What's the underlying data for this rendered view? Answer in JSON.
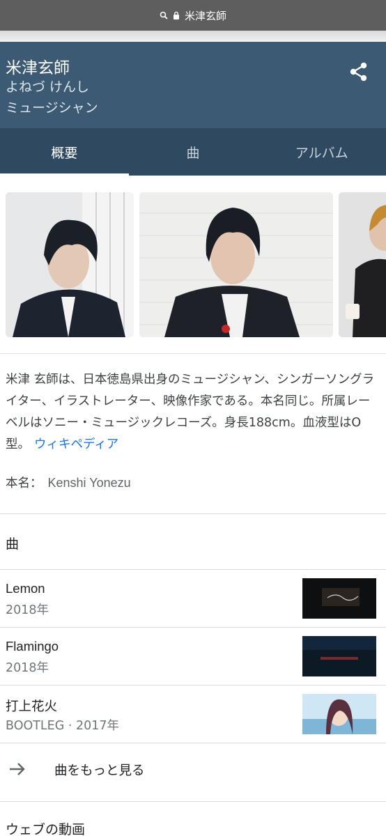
{
  "browser": {
    "url_text": "米津玄師"
  },
  "knowledge_panel": {
    "title": "米津玄師",
    "reading": "よねづ けんし",
    "type": "ミュージシャン"
  },
  "tabs": [
    {
      "label": "概要",
      "active": true
    },
    {
      "label": "曲",
      "active": false
    },
    {
      "label": "アルバム",
      "active": false
    }
  ],
  "description": {
    "text": "米津 玄師は、日本徳島県出身のミュージシャン、シンガーソングライター、イラストレーター、映像作家である。本名同じ。所属レーベルはソニー・ミュージックレコーズ。身長188cm。血液型はO型。",
    "source_link": "ウィキペディア"
  },
  "real_name": {
    "label": "本名：",
    "value": "Kenshi Yonezu"
  },
  "songs_section": {
    "title": "曲",
    "items": [
      {
        "name": "Lemon",
        "meta": "2018年"
      },
      {
        "name": "Flamingo",
        "meta": "2018年"
      },
      {
        "name": "打上花火",
        "meta": "BOOTLEG · 2017年"
      }
    ],
    "more_label": "曲をもっと見る"
  },
  "web_videos_title": "ウェブの動画",
  "colors": {
    "header": "#3c5a73",
    "tabs": "#2f4a60",
    "link": "#1a73e8"
  }
}
